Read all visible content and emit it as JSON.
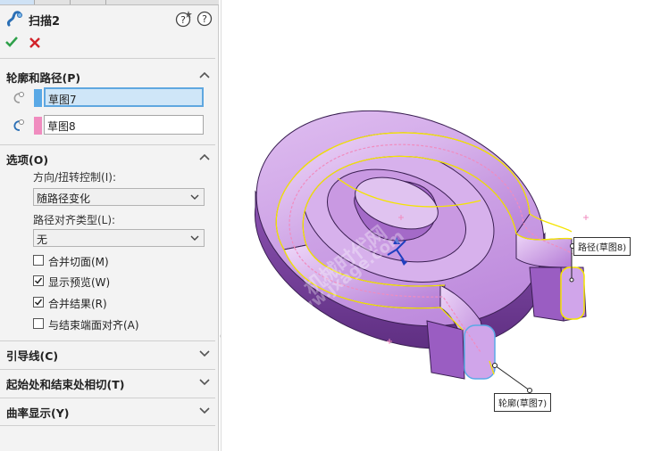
{
  "feature": {
    "title": "扫描2",
    "icon": "sweep-feature-icon",
    "help_icons": [
      "help-whats-new-icon",
      "help-icon"
    ]
  },
  "actions": {
    "ok": "checkmark-icon",
    "cancel": "close-icon"
  },
  "sections": {
    "profile_path": {
      "label": "轮廓和路径(P)",
      "profile_value": "草图7",
      "profile_color": "#5aa9e6",
      "path_value": "草图8",
      "path_color": "#f08cbf"
    },
    "options": {
      "label": "选项(O)",
      "orientation_label": "方向/扭转控制(I):",
      "orientation_value": "随路径变化",
      "align_label": "路径对齐类型(L):",
      "align_value": "无",
      "checkboxes": [
        {
          "label": "合并切面(M)",
          "checked": false
        },
        {
          "label": "显示预览(W)",
          "checked": true
        },
        {
          "label": "合并结果(R)",
          "checked": true
        },
        {
          "label": "与结束端面对齐(A)",
          "checked": false
        }
      ]
    },
    "guide_curves": {
      "label": "引导线(C)"
    },
    "tangency": {
      "label": "起始处和结束处相切(T)"
    },
    "curvature": {
      "label": "曲率显示(Y)"
    }
  },
  "viewport": {
    "path_callout": "路径(草图8)",
    "profile_callout": "轮廓(草图7)",
    "watermark_1": "机械时代网",
    "watermark_2": "www.jxage.com",
    "part_color": "#c88ee0",
    "highlight_color": "#f4e400"
  }
}
